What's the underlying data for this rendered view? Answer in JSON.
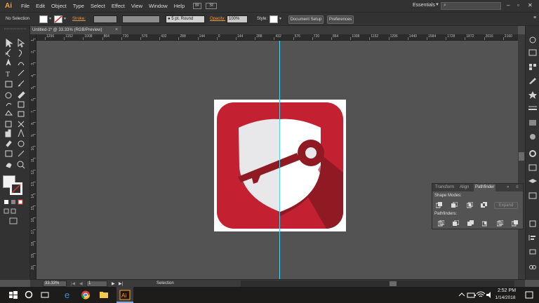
{
  "app": {
    "logo": "Ai"
  },
  "menu": [
    "File",
    "Edit",
    "Object",
    "Type",
    "Select",
    "Effect",
    "View",
    "Window",
    "Help"
  ],
  "menu_bridge": "Br",
  "menu_arrange": "St",
  "workspace": {
    "label": "Essentials",
    "search_icon": "search-icon"
  },
  "control_bar": {
    "selection_label": "No Selection",
    "stroke_label": "Stroke:",
    "brush_label": "5 pt. Round",
    "opacity_label": "Opacity:",
    "opacity_value": "100%",
    "style_label": "Style:",
    "document_setup": "Document Setup",
    "preferences": "Preferences"
  },
  "document": {
    "tab_title": "Untitled-1* @ 33.33% (RGB/Preview)"
  },
  "ruler_top": [
    "1296",
    "1152",
    "1008",
    "864",
    "720",
    "576",
    "432",
    "288",
    "144",
    "0",
    "144",
    "288",
    "432",
    "576",
    "720",
    "864",
    "1008",
    "1152",
    "1296",
    "1440",
    "1584",
    "1728",
    "1872",
    "2016",
    "2160"
  ],
  "ruler_left": [
    "1",
    "2",
    "3",
    "4",
    "5",
    "6",
    "7",
    "8",
    "9",
    "10",
    "11",
    "12",
    "13",
    "14",
    "15",
    "16",
    "17",
    "18",
    "19",
    "20"
  ],
  "pathfinder_panel": {
    "tabs": [
      "Transform",
      "Align",
      "Pathfinder"
    ],
    "active_tab": "Pathfinder",
    "shape_modes_label": "Shape Modes:",
    "pathfinders_label": "Pathfinders:",
    "expand_label": "Expand"
  },
  "status_bar": {
    "zoom": "33.33%",
    "artboard_number": "1",
    "tool_label": "Selection"
  },
  "taskbar": {
    "time": "2:52 PM",
    "date": "1/14/2018"
  },
  "colors": {
    "icon_red": "#c32032",
    "icon_dark_red": "#8f1a24",
    "shield_light": "#e8e8ea",
    "shield_white": "#ffffff",
    "guide": "#4fd1e8",
    "accent_orange": "#f29a3b"
  }
}
